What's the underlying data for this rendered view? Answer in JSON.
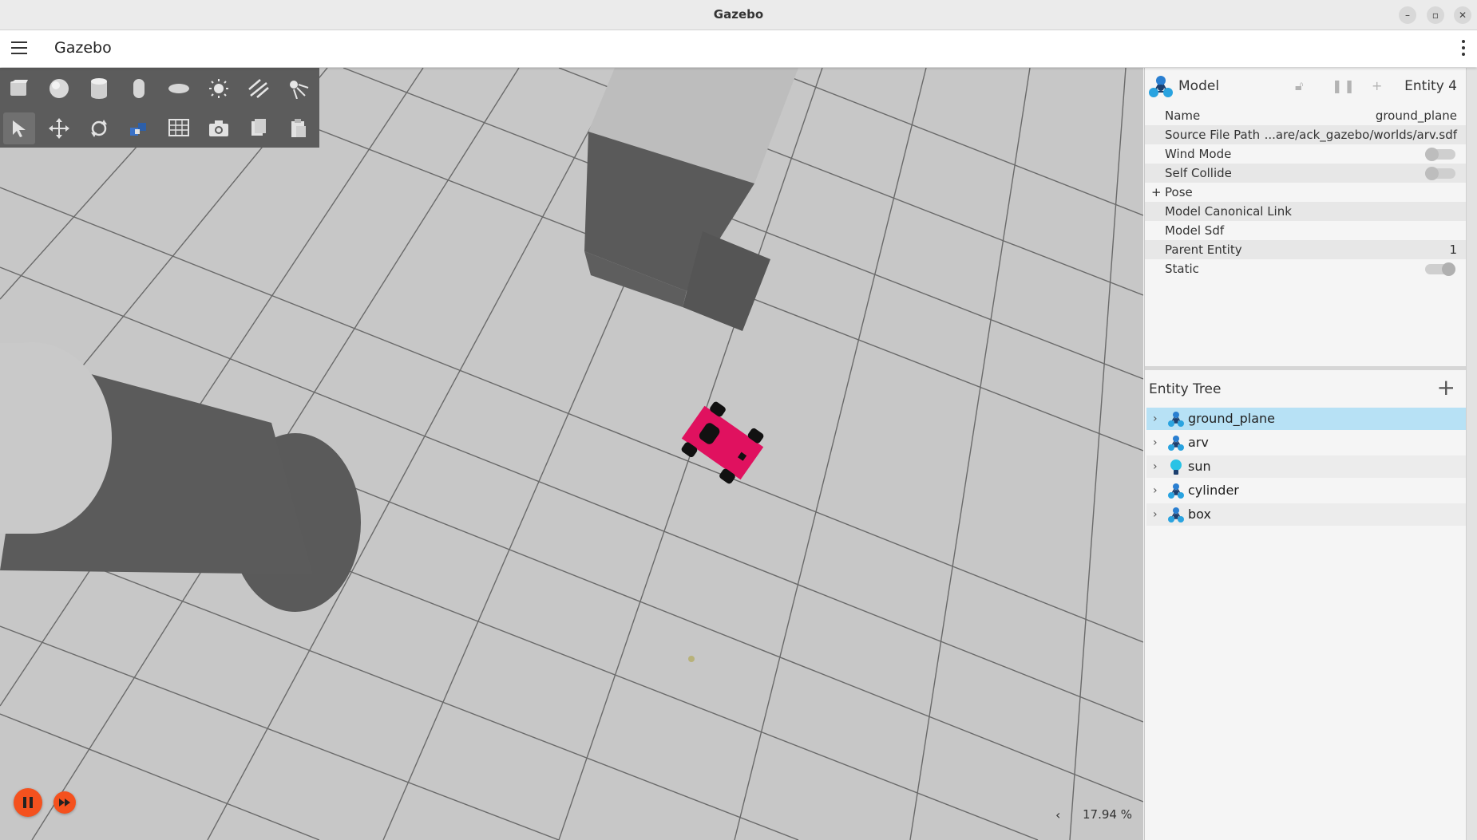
{
  "window": {
    "title": "Gazebo",
    "minimize": "–",
    "maximize": "▫",
    "close": "✕"
  },
  "menubar": {
    "app_name": "Gazebo"
  },
  "toolbar": {
    "row1": [
      "box-shape",
      "sphere-shape",
      "cylinder-shape",
      "capsule-shape",
      "ellipsoid-shape",
      "sun-light",
      "directional-light",
      "spot-light"
    ],
    "row2": [
      "select",
      "translate",
      "rotate",
      "snap",
      "grid",
      "screenshot",
      "copy",
      "paste"
    ]
  },
  "sim_controls": {
    "rtf_arrow": "‹",
    "rtf": "17.94 %"
  },
  "component_inspector": {
    "title": "Model",
    "entity": "Entity 4",
    "rows": [
      {
        "key": "Name",
        "value": "ground_plane"
      },
      {
        "key": "Source File Path",
        "value": "...are/ack_gazebo/worlds/arv.sdf"
      },
      {
        "key": "Wind Mode",
        "value": ""
      },
      {
        "key": "Self Collide",
        "value": ""
      },
      {
        "key": "Pose",
        "value": "",
        "prefix": "+"
      },
      {
        "key": "Model Canonical Link",
        "value": ""
      },
      {
        "key": "Model Sdf",
        "value": ""
      },
      {
        "key": "Parent Entity",
        "value": "1"
      },
      {
        "key": "Static",
        "value": ""
      }
    ],
    "toggles": {
      "wind_mode": false,
      "self_collide": false,
      "static": true
    }
  },
  "entity_tree": {
    "title": "Entity Tree",
    "add": "+",
    "items": [
      {
        "label": "ground_plane",
        "icon": "model-icon",
        "selected": true
      },
      {
        "label": "arv",
        "icon": "model-icon"
      },
      {
        "label": "sun",
        "icon": "light-icon"
      },
      {
        "label": "cylinder",
        "icon": "model-icon"
      },
      {
        "label": "box",
        "icon": "model-icon"
      }
    ]
  },
  "colors": {
    "accent": "#f4511e",
    "robot": "#e0115f",
    "selection": "#b7e1f5",
    "ground": "#c7c7c7"
  }
}
